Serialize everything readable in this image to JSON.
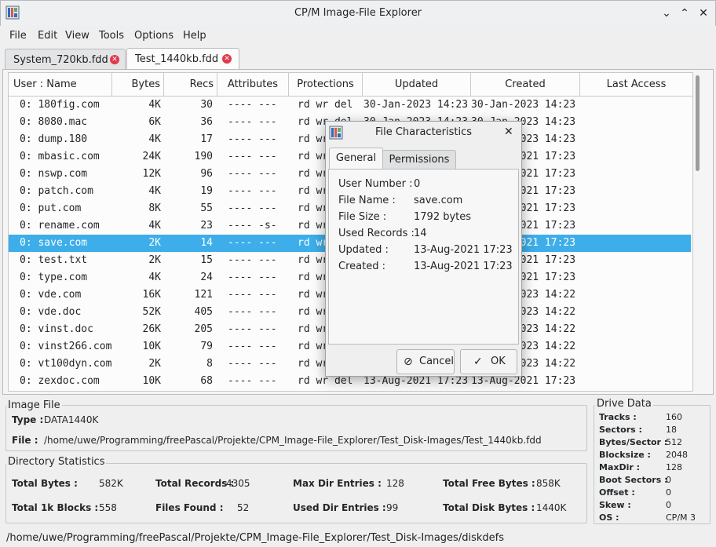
{
  "window": {
    "title": "CP/M Image-File Explorer",
    "app_icon": "disk-grid-icon"
  },
  "menu": [
    "File",
    "Edit",
    "View",
    "Tools",
    "Options",
    "Help"
  ],
  "tabs": [
    {
      "label": "System_720kb.fdd",
      "active": false
    },
    {
      "label": "Test_1440kb.fdd",
      "active": true
    }
  ],
  "table": {
    "headers": [
      "User : Name",
      "Bytes",
      "Recs",
      "Attributes",
      "Protections",
      "Updated",
      "Created",
      "Last Access"
    ],
    "rows": [
      {
        "name": "0: 180fig.com",
        "bytes": "4K",
        "recs": "30",
        "attr": "---- ---",
        "prot": "rd wr del",
        "updated": "30-Jan-2023 14:23",
        "created": "30-Jan-2023 14:23"
      },
      {
        "name": "0: 8080.mac",
        "bytes": "6K",
        "recs": "36",
        "attr": "---- ---",
        "prot": "rd wr del",
        "updated": "30-Jan-2023 14:23",
        "created": "30-Jan-2023 14:23"
      },
      {
        "name": "0: dump.180",
        "bytes": "4K",
        "recs": "17",
        "attr": "---- ---",
        "prot": "rd wr del",
        "updated": "30-Jan-2023 14:23",
        "created": "30-Jan-2023 14:23"
      },
      {
        "name": "0: mbasic.com",
        "bytes": "24K",
        "recs": "190",
        "attr": "---- ---",
        "prot": "rd wr del",
        "updated": "13-Aug-2021 17:23",
        "created": "13-Aug-2021 17:23"
      },
      {
        "name": "0: nswp.com",
        "bytes": "12K",
        "recs": "96",
        "attr": "---- ---",
        "prot": "rd wr del",
        "updated": "13-Aug-2021 17:23",
        "created": "13-Aug-2021 17:23"
      },
      {
        "name": "0: patch.com",
        "bytes": "4K",
        "recs": "19",
        "attr": "---- ---",
        "prot": "rd wr del",
        "updated": "13-Aug-2021 17:23",
        "created": "13-Aug-2021 17:23"
      },
      {
        "name": "0: put.com",
        "bytes": "8K",
        "recs": "55",
        "attr": "---- ---",
        "prot": "rd wr del",
        "updated": "13-Aug-2021 17:23",
        "created": "13-Aug-2021 17:23"
      },
      {
        "name": "0: rename.com",
        "bytes": "4K",
        "recs": "23",
        "attr": "---- -s-",
        "prot": "rd wr del",
        "updated": "13-Aug-2021 17:23",
        "created": "13-Aug-2021 17:23"
      },
      {
        "name": "0: save.com",
        "bytes": "2K",
        "recs": "14",
        "attr": "---- ---",
        "prot": "rd wr del",
        "updated": "13-Aug-2021 17:23",
        "created": "13-Aug-2021 17:23",
        "selected": true
      },
      {
        "name": "0: test.txt",
        "bytes": "2K",
        "recs": "15",
        "attr": "---- ---",
        "prot": "rd wr del",
        "updated": "13-Aug-2021 17:23",
        "created": "13-Aug-2021 17:23"
      },
      {
        "name": "0: type.com",
        "bytes": "4K",
        "recs": "24",
        "attr": "---- ---",
        "prot": "rd wr del",
        "updated": "13-Aug-2021 17:23",
        "created": "13-Aug-2021 17:23"
      },
      {
        "name": "0: vde.com",
        "bytes": "16K",
        "recs": "121",
        "attr": "---- ---",
        "prot": "rd wr del",
        "updated": "30-Jan-2023 14:22",
        "created": "30-Jan-2023 14:22"
      },
      {
        "name": "0: vde.doc",
        "bytes": "52K",
        "recs": "405",
        "attr": "---- ---",
        "prot": "rd wr del",
        "updated": "30-Jan-2023 14:22",
        "created": "30-Jan-2023 14:22"
      },
      {
        "name": "0: vinst.doc",
        "bytes": "26K",
        "recs": "205",
        "attr": "---- ---",
        "prot": "rd wr del",
        "updated": "30-Jan-2023 14:22",
        "created": "30-Jan-2023 14:22"
      },
      {
        "name": "0: vinst266.com",
        "bytes": "10K",
        "recs": "79",
        "attr": "---- ---",
        "prot": "rd wr del",
        "updated": "30-Jan-2023 14:22",
        "created": "30-Jan-2023 14:22"
      },
      {
        "name": "0: vt100dyn.com",
        "bytes": "2K",
        "recs": "8",
        "attr": "---- ---",
        "prot": "rd wr del",
        "updated": "30-Jan-2023 14:22",
        "created": "30-Jan-2023 14:22"
      },
      {
        "name": "0: zexdoc.com",
        "bytes": "10K",
        "recs": "68",
        "attr": "---- ---",
        "prot": "rd wr del",
        "updated": "13-Aug-2021 17:23",
        "created": "13-Aug-2021 17:23"
      }
    ]
  },
  "image_file": {
    "group_title": "Image File",
    "type_label": "Type :",
    "type_value": "DATA1440K",
    "file_label": "File :",
    "file_value": "/home/uwe/Programming/freePascal/Projekte/CPM_Image-File_Explorer/Test_Disk-Images/Test_1440kb.fdd"
  },
  "dir_stats": {
    "group_title": "Directory Statistics",
    "items": [
      {
        "label": "Total Bytes :",
        "value": "582K"
      },
      {
        "label": "Total Records :",
        "value": "4305"
      },
      {
        "label": "Max Dir Entries :",
        "value": "128"
      },
      {
        "label": "Total Free Bytes :",
        "value": "858K"
      },
      {
        "label": "Total 1k Blocks :",
        "value": "558"
      },
      {
        "label": "Files Found :",
        "value": "52"
      },
      {
        "label": "Used Dir Entries :",
        "value": "99"
      },
      {
        "label": "Total Disk Bytes :",
        "value": "1440K"
      }
    ]
  },
  "drive_data": {
    "group_title": "Drive Data",
    "items": [
      {
        "label": "Tracks :",
        "value": "160"
      },
      {
        "label": "Sectors :",
        "value": "18"
      },
      {
        "label": "Bytes/Sector :",
        "value": "512"
      },
      {
        "label": "Blocksize :",
        "value": "2048"
      },
      {
        "label": "MaxDir :",
        "value": "128"
      },
      {
        "label": "Boot Sectors :",
        "value": "0"
      },
      {
        "label": "Offset :",
        "value": "0"
      },
      {
        "label": "Skew :",
        "value": "0"
      },
      {
        "label": "OS :",
        "value": "CP/M 3"
      }
    ]
  },
  "status_bar": "/home/uwe/Programming/freePascal/Projekte/CPM_Image-File_Explorer/Test_Disk-Images/diskdefs",
  "dialog": {
    "title": "File Characteristics",
    "tabs": [
      "General",
      "Permissions"
    ],
    "fields": [
      {
        "label": "User Number :",
        "value": "0"
      },
      {
        "label": "File Name :",
        "value": "save.com"
      },
      {
        "label": "File Size :",
        "value": "1792 bytes"
      },
      {
        "label": "Used Records :",
        "value": "14"
      },
      {
        "label": "Updated :",
        "value": "13-Aug-2021 17:23"
      },
      {
        "label": "Created :",
        "value": "13-Aug-2021 17:23"
      }
    ],
    "cancel_label": "Cancel",
    "ok_label": "OK"
  },
  "colors": {
    "selection": "#3daee9",
    "tab_close": "#e2394b"
  }
}
